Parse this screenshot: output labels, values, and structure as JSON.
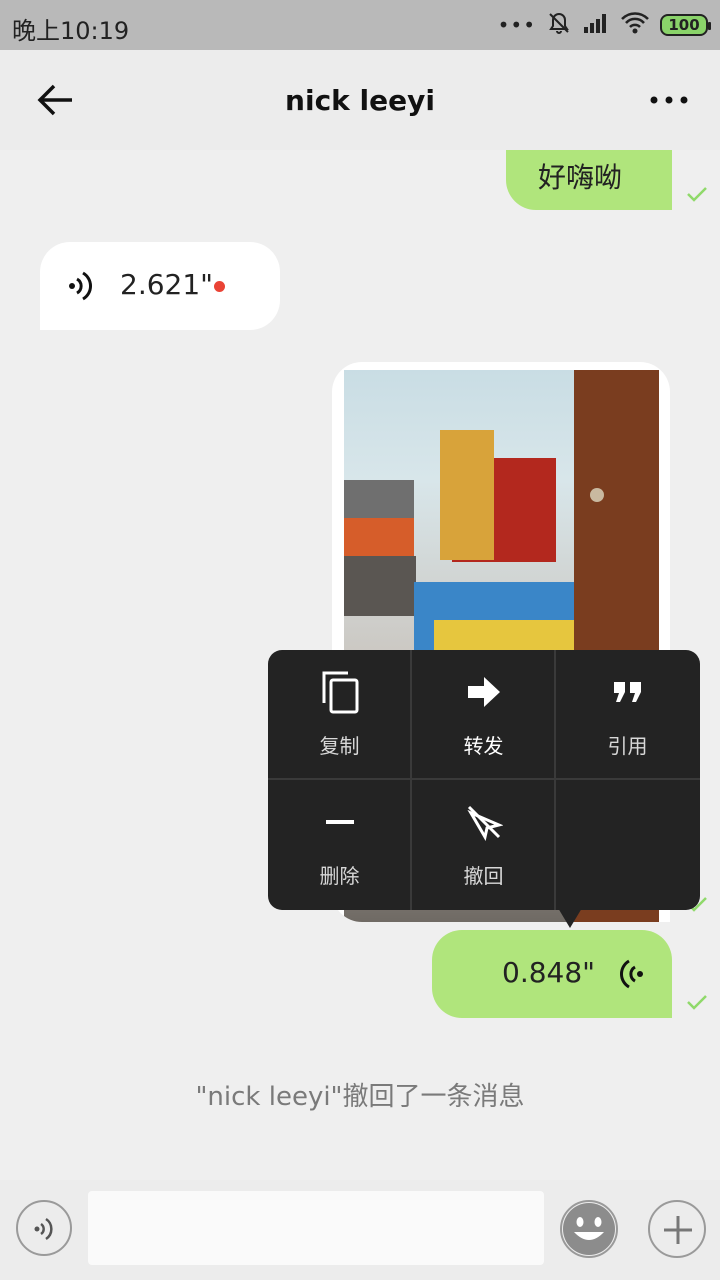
{
  "status_bar": {
    "time": "晚上10:19",
    "signal_dots": "•••",
    "battery": "100",
    "battery_color": "#8ad36a"
  },
  "header": {
    "title": "nick leeyi",
    "back_icon": "arrow-left-icon",
    "more_icon": "more-horizontal-icon"
  },
  "messages": [
    {
      "type": "text",
      "direction": "outgoing",
      "text": "好嗨呦",
      "status": "sent-check-icon"
    },
    {
      "type": "voice",
      "direction": "incoming",
      "duration": "2.621\"",
      "unread": true
    },
    {
      "type": "image",
      "direction": "outgoing",
      "status": "sent-check-icon"
    },
    {
      "type": "voice",
      "direction": "outgoing",
      "duration": "0.848\"",
      "status": "sent-check-icon"
    }
  ],
  "context_menu": {
    "items": [
      {
        "label": "复制",
        "icon": "copy-icon"
      },
      {
        "label": "转发",
        "icon": "forward-icon"
      },
      {
        "label": "引用",
        "icon": "quote-icon"
      },
      {
        "label": "删除",
        "icon": "delete-icon"
      },
      {
        "label": "撤回",
        "icon": "recall-icon"
      }
    ]
  },
  "recall_notice": "\"nick leeyi\"撤回了一条消息",
  "input_bar": {
    "voice_icon": "voice-toggle-icon",
    "emoji_icon": "emoji-icon",
    "plus_icon": "plus-icon",
    "input_value": ""
  },
  "colors": {
    "accent_green": "#b0e57c",
    "menu_bg": "#232323",
    "check_green": "#8fd96a"
  }
}
